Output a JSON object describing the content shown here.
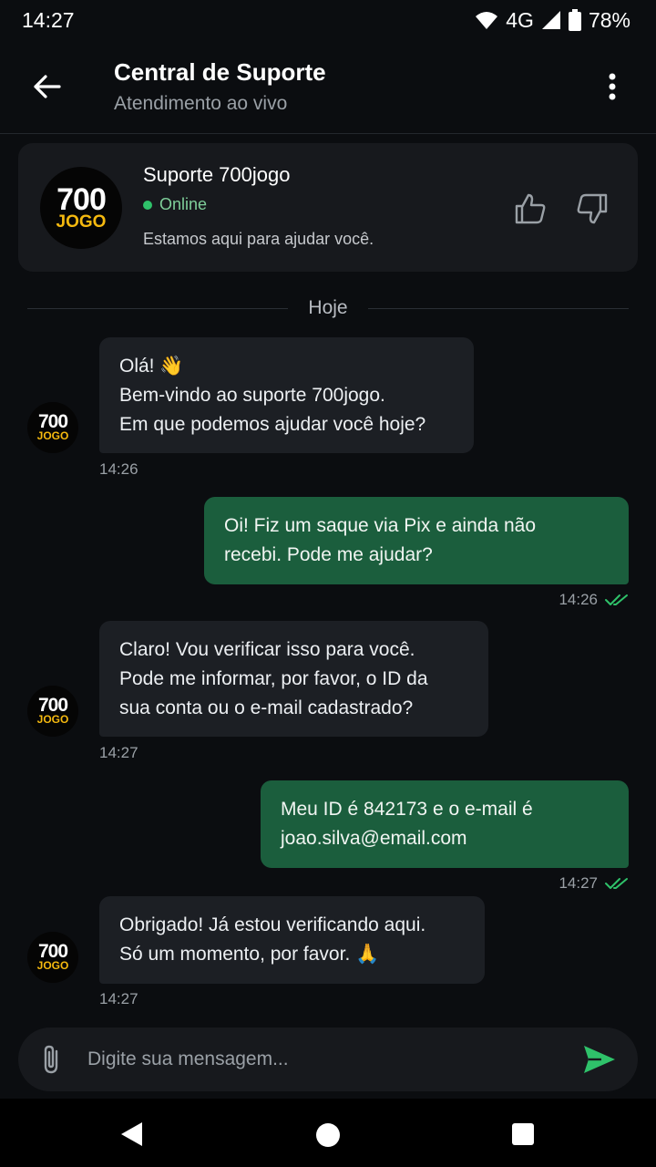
{
  "status_bar": {
    "time": "14:27",
    "network": "4G",
    "battery": "78%"
  },
  "header": {
    "title": "Central de Suporte",
    "subtitle": "Atendimento ao vivo"
  },
  "info_card": {
    "logo_number": "700",
    "logo_word": "JOGO",
    "name": "Suporte 700jogo",
    "status": "Online",
    "description": "Estamos aqui para ajudar você."
  },
  "day_separator": "Hoje",
  "messages": [
    {
      "text": "Olá! 👋\nBem-vindo ao suporte 700jogo.\nEm que podemos ajudar você hoje?",
      "time": "14:26"
    },
    {
      "text": "Oi! Fiz um saque via Pix e ainda não\nrecebi. Pode me ajudar?",
      "time": "14:26"
    },
    {
      "text": "Claro! Vou verificar isso para você.\nPode me informar, por favor, o ID da\nsua conta ou o e-mail cadastrado?",
      "time": "14:27"
    },
    {
      "text": "Meu ID é 842173 e o e-mail é\njoao.silva@email.com",
      "time": "14:27"
    },
    {
      "text": "Obrigado! Já estou verificando aqui.\nSó um momento, por favor. 🙏",
      "time": "14:27"
    }
  ],
  "composer": {
    "placeholder": "Digite sua mensagem..."
  },
  "colors": {
    "accent": "#2fc26a",
    "outgoing_bubble": "#1b5e3d",
    "incoming_bubble": "#1c1f24",
    "brand_yellow": "#f5b90f"
  }
}
